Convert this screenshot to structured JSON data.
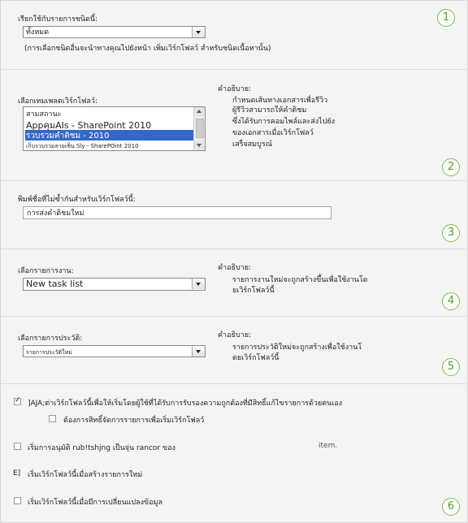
{
  "step_badges": [
    "1",
    "2",
    "3",
    "4",
    "5",
    "6"
  ],
  "section1": {
    "label": "เรียกใช้กับรายการชนิดนี้:",
    "select_value": "ทั้งหมด",
    "note": "(การเลือกชนิดอื่นจะนำทางคุณไปยังหน้า เพิ่มเวิร์กโฟลว์ สำหรับชนิดเนื้อหานั้น)"
  },
  "section2": {
    "label": "เลือกเทมเพลตเวิร์กโฟลว์:",
    "templates": [
      "สามสถานะ",
      "AppคุมAIs - SharePoint 2010",
      "รวบรวมคำติชม - 2010",
      "เก็บรวบรวมลายเซ็น Sly - SharePOint 2010"
    ],
    "selected_index": 2,
    "desc_title": "คำอธิบาย:",
    "desc_lines": [
      "กำหนดเส้นทางเอกสารเพื่อรีวิว",
      "ผู้รีวิวสามารถให้คำติชม",
      "ซึ่งได้รับการคอมไพล์และส่งไปยัง",
      "ของเอกสารเมื่อเวิร์กโฟลว์",
      "เสร็จสมบูรณ์"
    ]
  },
  "section3": {
    "label": "พิมพ์ชื่อที่ไม่ซ้ำกันสำหรับเวิร์กโฟลว์นี้:",
    "name_value": "การส่งคำติชมใหม่"
  },
  "section4": {
    "label": "เลือกรายการงาน:",
    "select_value": "New task list",
    "desc_title": "คำอธิบาย:",
    "desc_lines": [
      "รายการงานใหม่จะถูกสร้างขึ้นเพื่อใช้งานโด",
      "ยเวิร์กโฟลว์นี้"
    ]
  },
  "section5": {
    "label": "เลือกรายการประวัติ:",
    "select_value": "รายการประวัติใหม่",
    "desc_title": "คำอธิบาย:",
    "desc_lines": [
      "รายการประวัติใหม่จะถูกสร้างเพื่อใช้งานโ",
      "ดยเวิร์กโฟลว์นี้"
    ]
  },
  "section6": {
    "allow_label": "]AJA;ต่าเวิร์กโฟลว์นี้เพื่อให้เริ่มโดยผู้ใช้ที่ได้รับการรับรองความถูกต้องที่มีสิทธิ์แก้ไขรายการด้วยตนเอง",
    "require_manage_label": "ต้องการสิทธิ์จัดการรายการเพื่อเริ่มเวิร์กโฟลว์",
    "approval_label": "เริ่มการอนุมัติ rub!tshjng เป็นจุ่น rancor ของ",
    "approval_suffix": "item.",
    "create_label": "เริ่มเวิร์กโฟลว์นี้เมื่อสร้างรายการใหม่",
    "create_marker": "E]",
    "change_label": "เริ่มเวิร์กโฟลว์นี้เมื่อมีการเปลี่ยนแปลงข้อมูล"
  }
}
